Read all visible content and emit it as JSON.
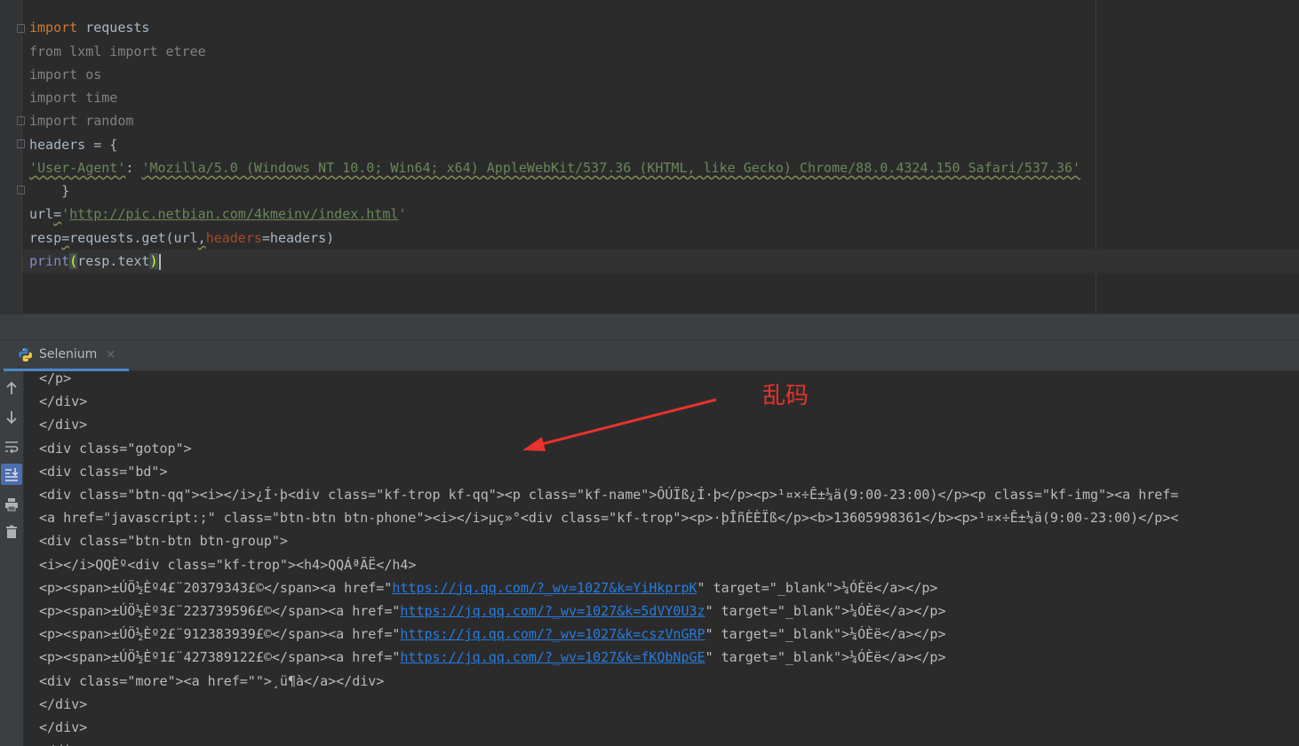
{
  "editor": {
    "lines": [
      {
        "segments": [
          {
            "t": "import",
            "c": "kw"
          },
          {
            "t": " requests",
            "c": ""
          }
        ]
      },
      {
        "segments": [
          {
            "t": "from lxml import etree",
            "c": "unused"
          }
        ]
      },
      {
        "segments": [
          {
            "t": "import os",
            "c": "unused"
          }
        ]
      },
      {
        "segments": [
          {
            "t": "import time",
            "c": "unused"
          }
        ]
      },
      {
        "segments": [
          {
            "t": "import random",
            "c": "unused"
          }
        ]
      },
      {
        "segments": [
          {
            "t": "headers = {",
            "c": ""
          }
        ]
      },
      {
        "segments": [
          {
            "t": "'User-Agent'",
            "c": "str uline"
          },
          {
            "t": ": ",
            "c": ""
          },
          {
            "t": "'Mozilla/5.0 (Windows NT 10.0; Win64; x64) AppleWebKit/537.36 (KHTML, like Gecko) Chrome/88.0.4324.150 Safari/537.36'",
            "c": "str uline"
          }
        ]
      },
      {
        "segments": [
          {
            "t": "    }",
            "c": ""
          }
        ]
      },
      {
        "segments": [
          {
            "t": "url",
            "c": ""
          },
          {
            "t": "=",
            "c": "uline"
          },
          {
            "t": "'",
            "c": "str"
          },
          {
            "t": "http://pic.netbian.com/4kmeinv/index.html",
            "c": "str link"
          },
          {
            "t": "'",
            "c": "str"
          }
        ]
      },
      {
        "segments": [
          {
            "t": "resp",
            "c": ""
          },
          {
            "t": "=",
            "c": "uline"
          },
          {
            "t": "requests.get(url",
            "c": ""
          },
          {
            "t": ",",
            "c": "uline"
          },
          {
            "t": "headers",
            "c": "param"
          },
          {
            "t": "=headers)",
            "c": ""
          }
        ]
      },
      {
        "segments": [
          {
            "t": "print",
            "c": "builtin"
          },
          {
            "t": "(",
            "c": "bracket-hl"
          },
          {
            "t": "resp.text",
            "c": ""
          },
          {
            "t": ")",
            "c": "bracket-hl"
          }
        ]
      }
    ]
  },
  "run_tab": {
    "label": "Selenium",
    "close": "×",
    "icon": "python-icon"
  },
  "toolbar": {
    "icons": [
      "arrow-up-icon",
      "arrow-down-icon",
      "soft-wrap-icon",
      "scroll-to-end-icon",
      "print-icon",
      "trash-icon"
    ]
  },
  "console": {
    "lines": [
      [
        {
          "t": "</p>"
        }
      ],
      [
        {
          "t": "</div>"
        }
      ],
      [
        {
          "t": "</div>"
        }
      ],
      [
        {
          "t": "<div class=\"gotop\">"
        }
      ],
      [
        {
          "t": "<div class=\"bd\">"
        }
      ],
      [
        {
          "t": "<div class=\"btn-qq\"><i></i>¿Í·þ<div class=\"kf-trop kf-qq\"><p class=\"kf-name\">ÔÚÏß¿Í·þ</p><p>¹¤×÷Ê±¼ä(9:00-23:00)</p><p class=\"kf-img\"><a href="
        }
      ],
      [
        {
          "t": "<a href=\"javascript:;\" class=\"btn-btn btn-phone\"><i></i>µç»°<div class=\"kf-trop\"><p>·þÎñÈÈÏß</p><b>13605998361</b><p>¹¤×÷Ê±¼ä(9:00-23:00)</p><"
        }
      ],
      [
        {
          "t": "<div class=\"btn-btn btn-group\">"
        }
      ],
      [
        {
          "t": "<i></i>QQÈº<div class=\"kf-trop\"><h4>QQÁªÃË</h4>"
        }
      ],
      [
        {
          "t": "<p><span>±ÚÖ½Èº4£¨20379343£©</span><a href=\""
        },
        {
          "t": "https://jq.qq.com/?_wv=1027&k=YiHkprpK",
          "link": true
        },
        {
          "t": "\" target=\"_blank\">¼ÓÈë</a></p>"
        }
      ],
      [
        {
          "t": "<p><span>±ÚÖ½Èº3£¨223739596£©</span><a href=\""
        },
        {
          "t": "https://jq.qq.com/?_wv=1027&k=5dVY0U3z",
          "link": true
        },
        {
          "t": "\" target=\"_blank\">¼ÓÈë</a></p>"
        }
      ],
      [
        {
          "t": "<p><span>±ÚÖ½Èº2£¨912383939£©</span><a href=\""
        },
        {
          "t": "https://jq.qq.com/?_wv=1027&k=cszVnGRP",
          "link": true
        },
        {
          "t": "\" target=\"_blank\">¼ÓÈë</a></p>"
        }
      ],
      [
        {
          "t": "<p><span>±ÚÖ½Èº1£¨427389122£©</span><a href=\""
        },
        {
          "t": "https://jq.qq.com/?_wv=1027&k=fKQbNpGE",
          "link": true
        },
        {
          "t": "\" target=\"_blank\">¼ÓÈë</a></p>"
        }
      ],
      [
        {
          "t": "<div class=\"more\"><a href=\"\">¸ü¶à</a></div>"
        }
      ],
      [
        {
          "t": "</div>"
        }
      ],
      [
        {
          "t": "</div>"
        }
      ],
      [
        {
          "t": "</div>"
        }
      ]
    ]
  },
  "annotation": {
    "text": "乱码",
    "color": "#e8322c"
  }
}
